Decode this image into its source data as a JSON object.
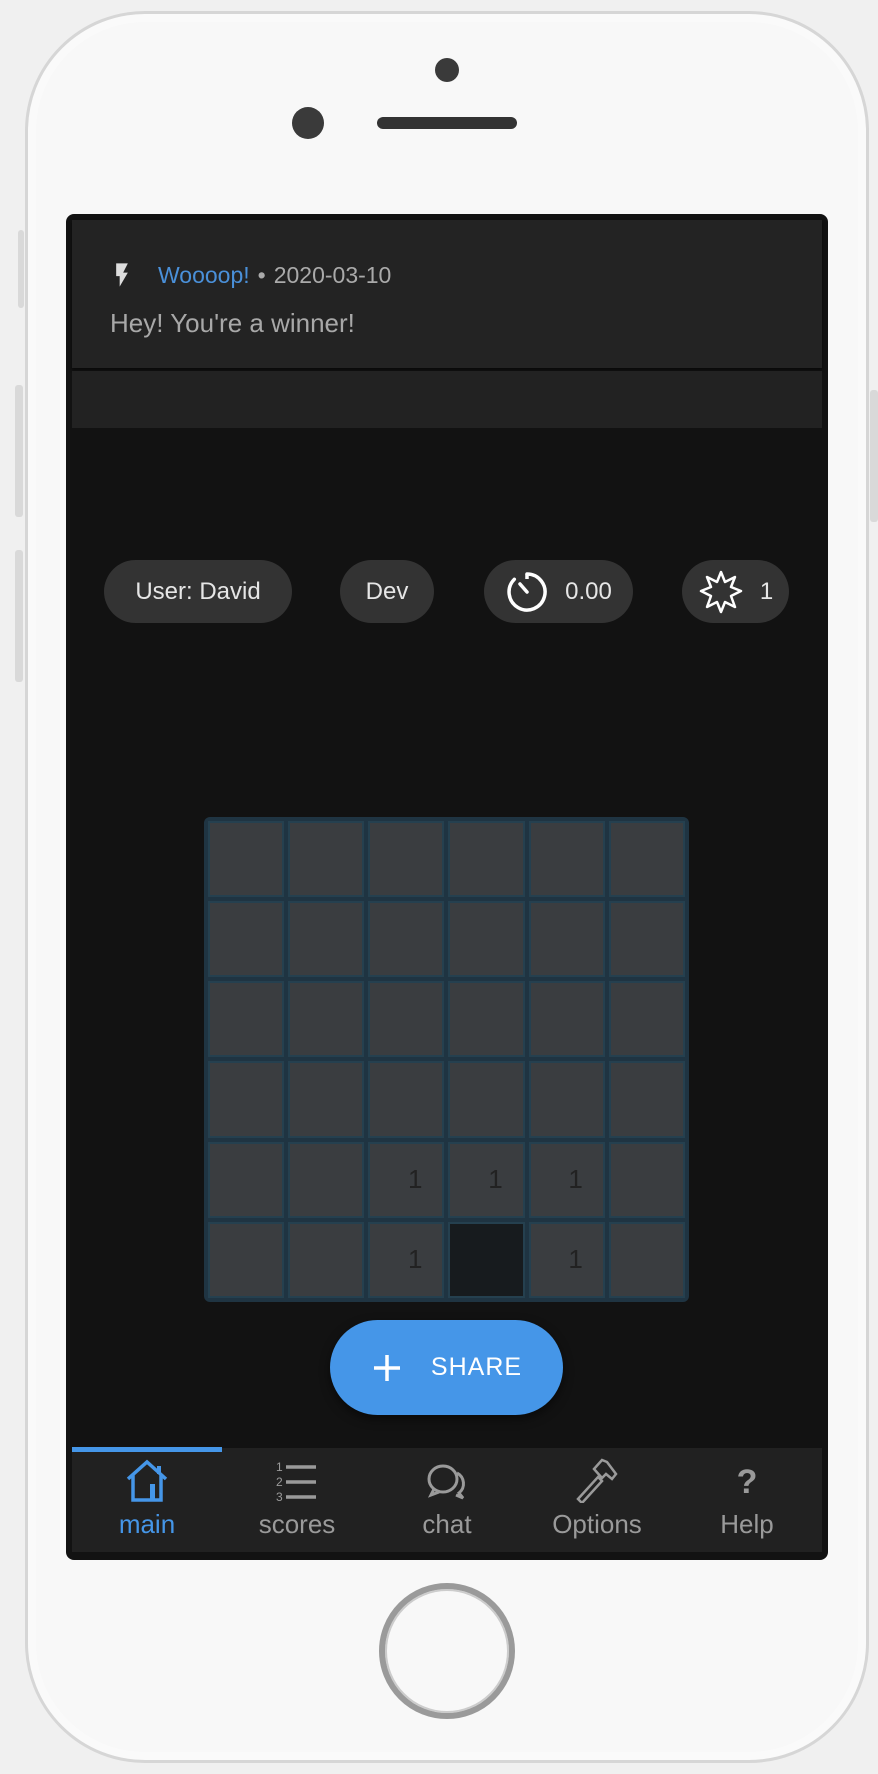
{
  "notification": {
    "icon": "lightning-icon",
    "title": "Woooop!",
    "separator": "•",
    "date": "2020-03-10",
    "message": "Hey! You're a winner!"
  },
  "status": {
    "user": "User: David",
    "mode": "Dev",
    "timer": "0.00",
    "mines": "1"
  },
  "board": {
    "rows": [
      [
        "",
        "",
        "",
        "",
        "",
        ""
      ],
      [
        "",
        "",
        "",
        "",
        "",
        ""
      ],
      [
        "",
        "",
        "",
        "",
        "",
        ""
      ],
      [
        "",
        "",
        "",
        "",
        "",
        ""
      ],
      [
        "",
        "",
        "1",
        "1",
        "1",
        ""
      ],
      [
        "",
        "",
        "1",
        "open",
        "1",
        ""
      ]
    ]
  },
  "share_button": {
    "label": "SHARE",
    "icon": "plus-icon"
  },
  "tabs": [
    {
      "label": "main",
      "icon": "home-icon",
      "active": true
    },
    {
      "label": "scores",
      "icon": "numbered-list-icon"
    },
    {
      "label": "chat",
      "icon": "chat-bubbles-icon"
    },
    {
      "label": "Options",
      "icon": "hammer-icon"
    },
    {
      "label": "Help",
      "icon": "question-icon"
    }
  ],
  "colors": {
    "accent": "#4596e8",
    "background": "#121212",
    "cell": "#3a3d40",
    "grid": "#1f3442"
  }
}
